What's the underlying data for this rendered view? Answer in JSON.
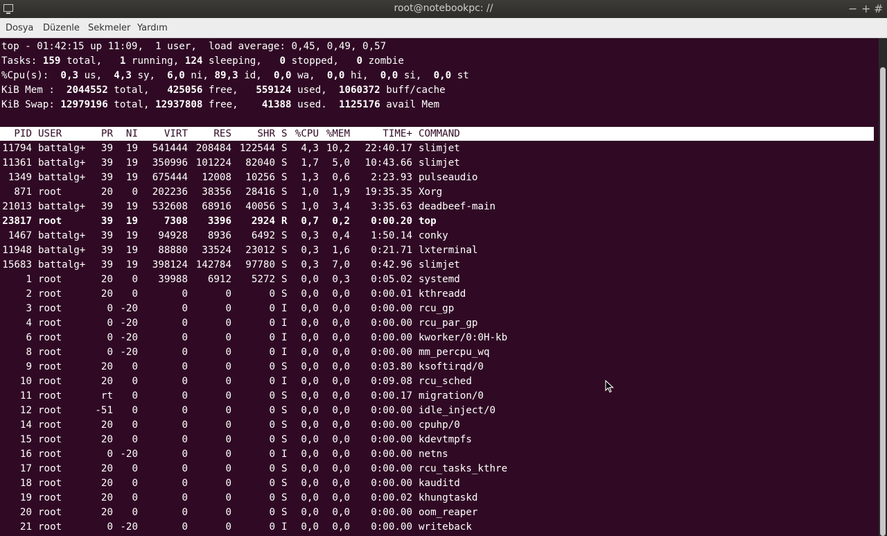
{
  "window": {
    "title": "root@notebookpc: //",
    "buttons": [
      "−",
      "+",
      "#"
    ]
  },
  "menu": [
    "Dosya",
    "Düzenle",
    "Sekmeler",
    "Yardım"
  ],
  "summary": {
    "line1": "top - 01:42:15 up 11:09,  1 user,  load average: 0,45, 0,49, 0,57",
    "line2": [
      {
        "t": "Tasks: ",
        "b": false
      },
      {
        "t": "159",
        "b": true
      },
      {
        "t": " total,   ",
        "b": false
      },
      {
        "t": "1",
        "b": true
      },
      {
        "t": " running, ",
        "b": false
      },
      {
        "t": "124",
        "b": true
      },
      {
        "t": " sleeping,   ",
        "b": false
      },
      {
        "t": "0",
        "b": true
      },
      {
        "t": " stopped,   ",
        "b": false
      },
      {
        "t": "0",
        "b": true
      },
      {
        "t": " zombie",
        "b": false
      }
    ],
    "line3": [
      {
        "t": "%Cpu(s):  ",
        "b": false
      },
      {
        "t": "0,3",
        "b": true
      },
      {
        "t": " us,  ",
        "b": false
      },
      {
        "t": "4,3",
        "b": true
      },
      {
        "t": " sy,  ",
        "b": false
      },
      {
        "t": "6,0",
        "b": true
      },
      {
        "t": " ni, ",
        "b": false
      },
      {
        "t": "89,3",
        "b": true
      },
      {
        "t": " id,  ",
        "b": false
      },
      {
        "t": "0,0",
        "b": true
      },
      {
        "t": " wa,  ",
        "b": false
      },
      {
        "t": "0,0",
        "b": true
      },
      {
        "t": " hi,  ",
        "b": false
      },
      {
        "t": "0,0",
        "b": true
      },
      {
        "t": " si,  ",
        "b": false
      },
      {
        "t": "0,0",
        "b": true
      },
      {
        "t": " st",
        "b": false
      }
    ],
    "line4": [
      {
        "t": "KiB Mem :  ",
        "b": false
      },
      {
        "t": "2044552",
        "b": true
      },
      {
        "t": " total,   ",
        "b": false
      },
      {
        "t": "425056",
        "b": true
      },
      {
        "t": " free,   ",
        "b": false
      },
      {
        "t": "559124",
        "b": true
      },
      {
        "t": " used,  ",
        "b": false
      },
      {
        "t": "1060372",
        "b": true
      },
      {
        "t": " buff/cache",
        "b": false
      }
    ],
    "line5": [
      {
        "t": "KiB Swap: ",
        "b": false
      },
      {
        "t": "12979196",
        "b": true
      },
      {
        "t": " total, ",
        "b": false
      },
      {
        "t": "12937808",
        "b": true
      },
      {
        "t": " free,    ",
        "b": false
      },
      {
        "t": "41388",
        "b": true
      },
      {
        "t": " used.  ",
        "b": false
      },
      {
        "t": "1125176",
        "b": true
      },
      {
        "t": " avail Mem",
        "b": false
      }
    ]
  },
  "table": {
    "columns": [
      "PID",
      "USER",
      "PR",
      "NI",
      "VIRT",
      "RES",
      "SHR",
      "S",
      "%CPU",
      "%MEM",
      "TIME+",
      "COMMAND"
    ],
    "rows": [
      [
        "11794",
        "battalg+",
        "39",
        "19",
        "541444",
        "208484",
        "122544",
        "S",
        "4,3",
        "10,2",
        "22:40.17",
        "slimjet"
      ],
      [
        "11361",
        "battalg+",
        "39",
        "19",
        "350996",
        "101224",
        "82040",
        "S",
        "1,7",
        "5,0",
        "10:43.66",
        "slimjet"
      ],
      [
        "1349",
        "battalg+",
        "39",
        "19",
        "675444",
        "12008",
        "10256",
        "S",
        "1,3",
        "0,6",
        "2:23.93",
        "pulseaudio"
      ],
      [
        "871",
        "root",
        "20",
        "0",
        "202236",
        "38356",
        "28416",
        "S",
        "1,0",
        "1,9",
        "19:35.35",
        "Xorg"
      ],
      [
        "21013",
        "battalg+",
        "39",
        "19",
        "532608",
        "68916",
        "40056",
        "S",
        "1,0",
        "3,4",
        "3:35.63",
        "deadbeef-main"
      ],
      [
        "23817",
        "root",
        "39",
        "19",
        "7308",
        "3396",
        "2924",
        "R",
        "0,7",
        "0,2",
        "0:00.20",
        "top"
      ],
      [
        "1467",
        "battalg+",
        "39",
        "19",
        "94928",
        "8936",
        "6492",
        "S",
        "0,3",
        "0,4",
        "1:50.14",
        "conky"
      ],
      [
        "11948",
        "battalg+",
        "39",
        "19",
        "88880",
        "33524",
        "23012",
        "S",
        "0,3",
        "1,6",
        "0:21.71",
        "lxterminal"
      ],
      [
        "15683",
        "battalg+",
        "39",
        "19",
        "398124",
        "142784",
        "97780",
        "S",
        "0,3",
        "7,0",
        "0:42.96",
        "slimjet"
      ],
      [
        "1",
        "root",
        "20",
        "0",
        "39988",
        "6912",
        "5272",
        "S",
        "0,0",
        "0,3",
        "0:05.02",
        "systemd"
      ],
      [
        "2",
        "root",
        "20",
        "0",
        "0",
        "0",
        "0",
        "S",
        "0,0",
        "0,0",
        "0:00.01",
        "kthreadd"
      ],
      [
        "3",
        "root",
        "0",
        "-20",
        "0",
        "0",
        "0",
        "I",
        "0,0",
        "0,0",
        "0:00.00",
        "rcu_gp"
      ],
      [
        "4",
        "root",
        "0",
        "-20",
        "0",
        "0",
        "0",
        "I",
        "0,0",
        "0,0",
        "0:00.00",
        "rcu_par_gp"
      ],
      [
        "6",
        "root",
        "0",
        "-20",
        "0",
        "0",
        "0",
        "I",
        "0,0",
        "0,0",
        "0:00.00",
        "kworker/0:0H-kb"
      ],
      [
        "8",
        "root",
        "0",
        "-20",
        "0",
        "0",
        "0",
        "I",
        "0,0",
        "0,0",
        "0:00.00",
        "mm_percpu_wq"
      ],
      [
        "9",
        "root",
        "20",
        "0",
        "0",
        "0",
        "0",
        "S",
        "0,0",
        "0,0",
        "0:03.80",
        "ksoftirqd/0"
      ],
      [
        "10",
        "root",
        "20",
        "0",
        "0",
        "0",
        "0",
        "I",
        "0,0",
        "0,0",
        "0:09.08",
        "rcu_sched"
      ],
      [
        "11",
        "root",
        "rt",
        "0",
        "0",
        "0",
        "0",
        "S",
        "0,0",
        "0,0",
        "0:00.17",
        "migration/0"
      ],
      [
        "12",
        "root",
        "-51",
        "0",
        "0",
        "0",
        "0",
        "S",
        "0,0",
        "0,0",
        "0:00.00",
        "idle_inject/0"
      ],
      [
        "14",
        "root",
        "20",
        "0",
        "0",
        "0",
        "0",
        "S",
        "0,0",
        "0,0",
        "0:00.00",
        "cpuhp/0"
      ],
      [
        "15",
        "root",
        "20",
        "0",
        "0",
        "0",
        "0",
        "S",
        "0,0",
        "0,0",
        "0:00.00",
        "kdevtmpfs"
      ],
      [
        "16",
        "root",
        "0",
        "-20",
        "0",
        "0",
        "0",
        "I",
        "0,0",
        "0,0",
        "0:00.00",
        "netns"
      ],
      [
        "17",
        "root",
        "20",
        "0",
        "0",
        "0",
        "0",
        "S",
        "0,0",
        "0,0",
        "0:00.00",
        "rcu_tasks_kthre"
      ],
      [
        "18",
        "root",
        "20",
        "0",
        "0",
        "0",
        "0",
        "S",
        "0,0",
        "0,0",
        "0:00.00",
        "kauditd"
      ],
      [
        "19",
        "root",
        "20",
        "0",
        "0",
        "0",
        "0",
        "S",
        "0,0",
        "0,0",
        "0:00.02",
        "khungtaskd"
      ],
      [
        "20",
        "root",
        "20",
        "0",
        "0",
        "0",
        "0",
        "S",
        "0,0",
        "0,0",
        "0:00.00",
        "oom_reaper"
      ],
      [
        "21",
        "root",
        "0",
        "-20",
        "0",
        "0",
        "0",
        "I",
        "0,0",
        "0,0",
        "0:00.00",
        "writeback"
      ]
    ],
    "highlight_pid": "23817"
  },
  "icons": {
    "app": "terminal-icon",
    "cursor": "mouse-pointer-icon"
  }
}
